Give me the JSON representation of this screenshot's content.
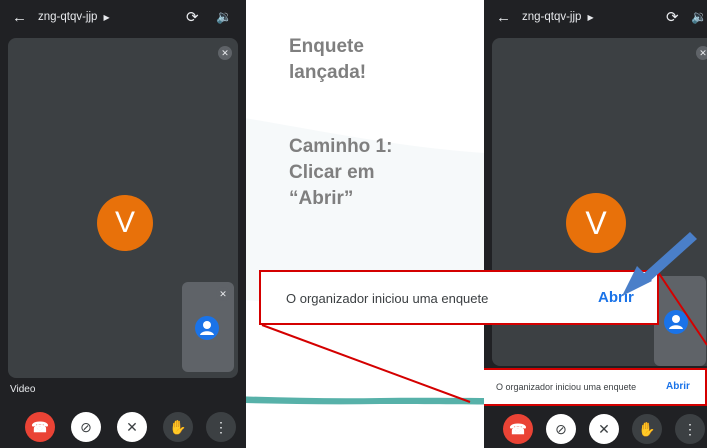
{
  "meeting": {
    "code": "zng-qtqv-jjp",
    "avatar_initial": "V",
    "video_label": "Video"
  },
  "heading": {
    "line1": "Enquete",
    "line2": "lançada!",
    "line3": "Caminho 1:",
    "line4": "Clicar em",
    "line5": "“Abrir”"
  },
  "notification": {
    "text": "O organizador iniciou uma enquete",
    "action": "Abrir"
  },
  "icons": {
    "back": "arrow-back-icon",
    "switch_camera": "switch-camera-icon",
    "speaker": "speaker-icon",
    "mic_off": "mic-off-icon",
    "end_call": "end-call-icon",
    "camera_off": "camera-off-icon",
    "raise_hand": "raise-hand-icon",
    "more": "more-vert-icon",
    "person": "person-icon"
  },
  "colors": {
    "end_call": "#ea4335",
    "avatar": "#e8710a",
    "link_blue": "#1a73e8",
    "highlight_red": "#d40000",
    "arrow_blue": "#4a7fc9"
  }
}
